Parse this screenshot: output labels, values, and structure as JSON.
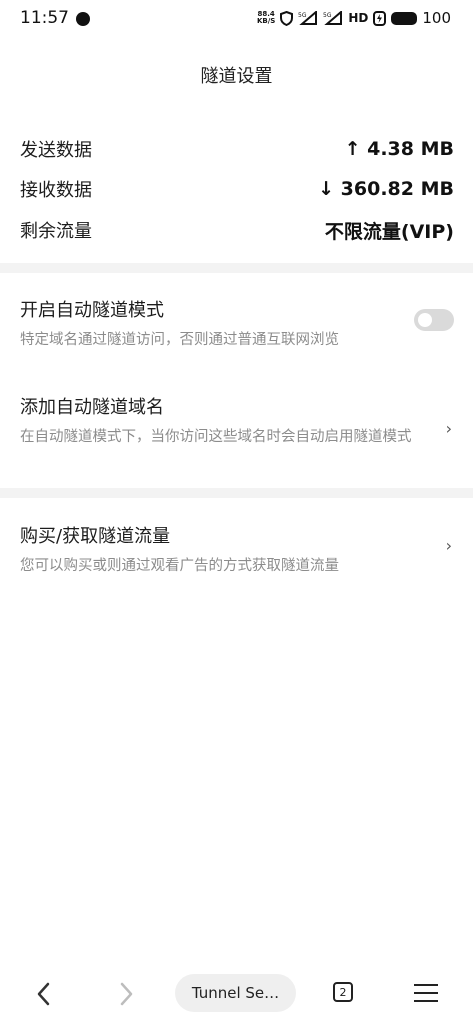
{
  "status_bar": {
    "time": "11:57",
    "speed_value": "88.4",
    "speed_unit": "KB/S",
    "signal_5g": "5G",
    "hd_label": "HD",
    "battery_pct": "100"
  },
  "page_title": "隧道设置",
  "stats": {
    "sent_label": "发送数据",
    "sent_value": "↑ 4.38 MB",
    "received_label": "接收数据",
    "received_value": "↓ 360.82 MB",
    "remaining_label": "剩余流量",
    "remaining_value": "不限流量(VIP)"
  },
  "settings": {
    "auto_tunnel_title": "开启自动隧道模式",
    "auto_tunnel_desc": "特定域名通过隧道访问，否则通过普通互联网浏览",
    "auto_tunnel_enabled": false,
    "add_domain_title": "添加自动隧道域名",
    "add_domain_desc": "在自动隧道模式下，当你访问这些域名时会自动启用隧道模式",
    "buy_title": "购买/获取隧道流量",
    "buy_desc": "您可以购买或则通过观看广告的方式获取隧道流量"
  },
  "bottom_nav": {
    "tab_title": "Tunnel Se…",
    "tab_count": "2"
  }
}
